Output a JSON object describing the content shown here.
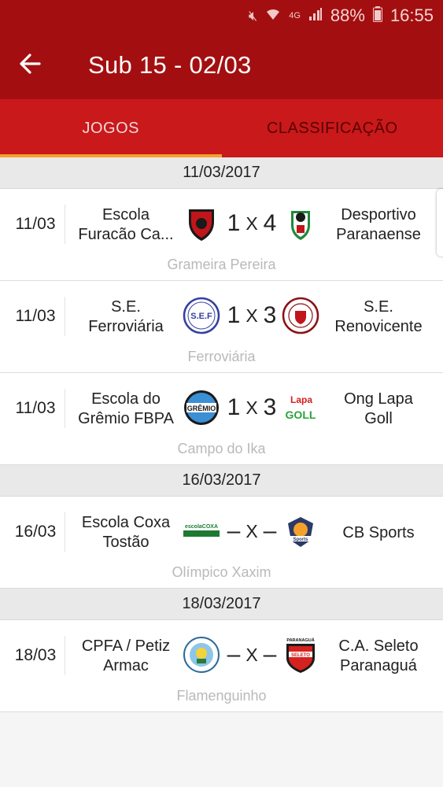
{
  "status_bar": {
    "battery": "88%",
    "time": "16:55"
  },
  "app_bar": {
    "title": "Sub 15 - 02/03"
  },
  "tabs": [
    {
      "label": "JOGOS"
    },
    {
      "label": "CLASSIFICAÇÃO"
    }
  ],
  "groups": [
    {
      "date": "11/03/2017",
      "matches": [
        {
          "date": "11/03",
          "home": [
            "Escola",
            "Furacão Ca..."
          ],
          "home_score": "1",
          "sep": "X",
          "away_score": "4",
          "away": [
            "Desportivo",
            "Paranaense"
          ],
          "venue": "Grameira Pereira"
        },
        {
          "date": "11/03",
          "home": [
            "S.E.",
            "Ferroviária"
          ],
          "home_score": "1",
          "sep": "X",
          "away_score": "3",
          "away": [
            "S.E.",
            "Renovicente"
          ],
          "venue": "Ferroviária"
        },
        {
          "date": "11/03",
          "home": [
            "Escola do",
            "Grêmio FBPA"
          ],
          "home_score": "1",
          "sep": "X",
          "away_score": "3",
          "away": [
            "Ong Lapa",
            "Goll"
          ],
          "venue": "Campo do Ika"
        }
      ]
    },
    {
      "date": "16/03/2017",
      "matches": [
        {
          "date": "16/03",
          "home": [
            "Escola Coxa",
            "Tostão"
          ],
          "home_score": "–",
          "sep": "X",
          "away_score": "–",
          "away": [
            "CB Sports"
          ],
          "venue": "Olímpico Xaxim"
        }
      ]
    },
    {
      "date": "18/03/2017",
      "matches": [
        {
          "date": "18/03",
          "home": [
            "CPFA / Petiz",
            "Armac"
          ],
          "home_score": "–",
          "sep": "X",
          "away_score": "–",
          "away": [
            "C.A. Seleto",
            "Paranaguá"
          ],
          "venue": "Flamenguinho"
        }
      ]
    }
  ],
  "crest_text": {
    "sef": "S.E.F",
    "gremio": "GRÊMIO",
    "lapa": "Lapa",
    "goll": "GOLL",
    "coxa": "escolaCOXA",
    "sports": "Sports",
    "paranagua": "PARANAGUÁ",
    "seleto": "SELETO"
  }
}
